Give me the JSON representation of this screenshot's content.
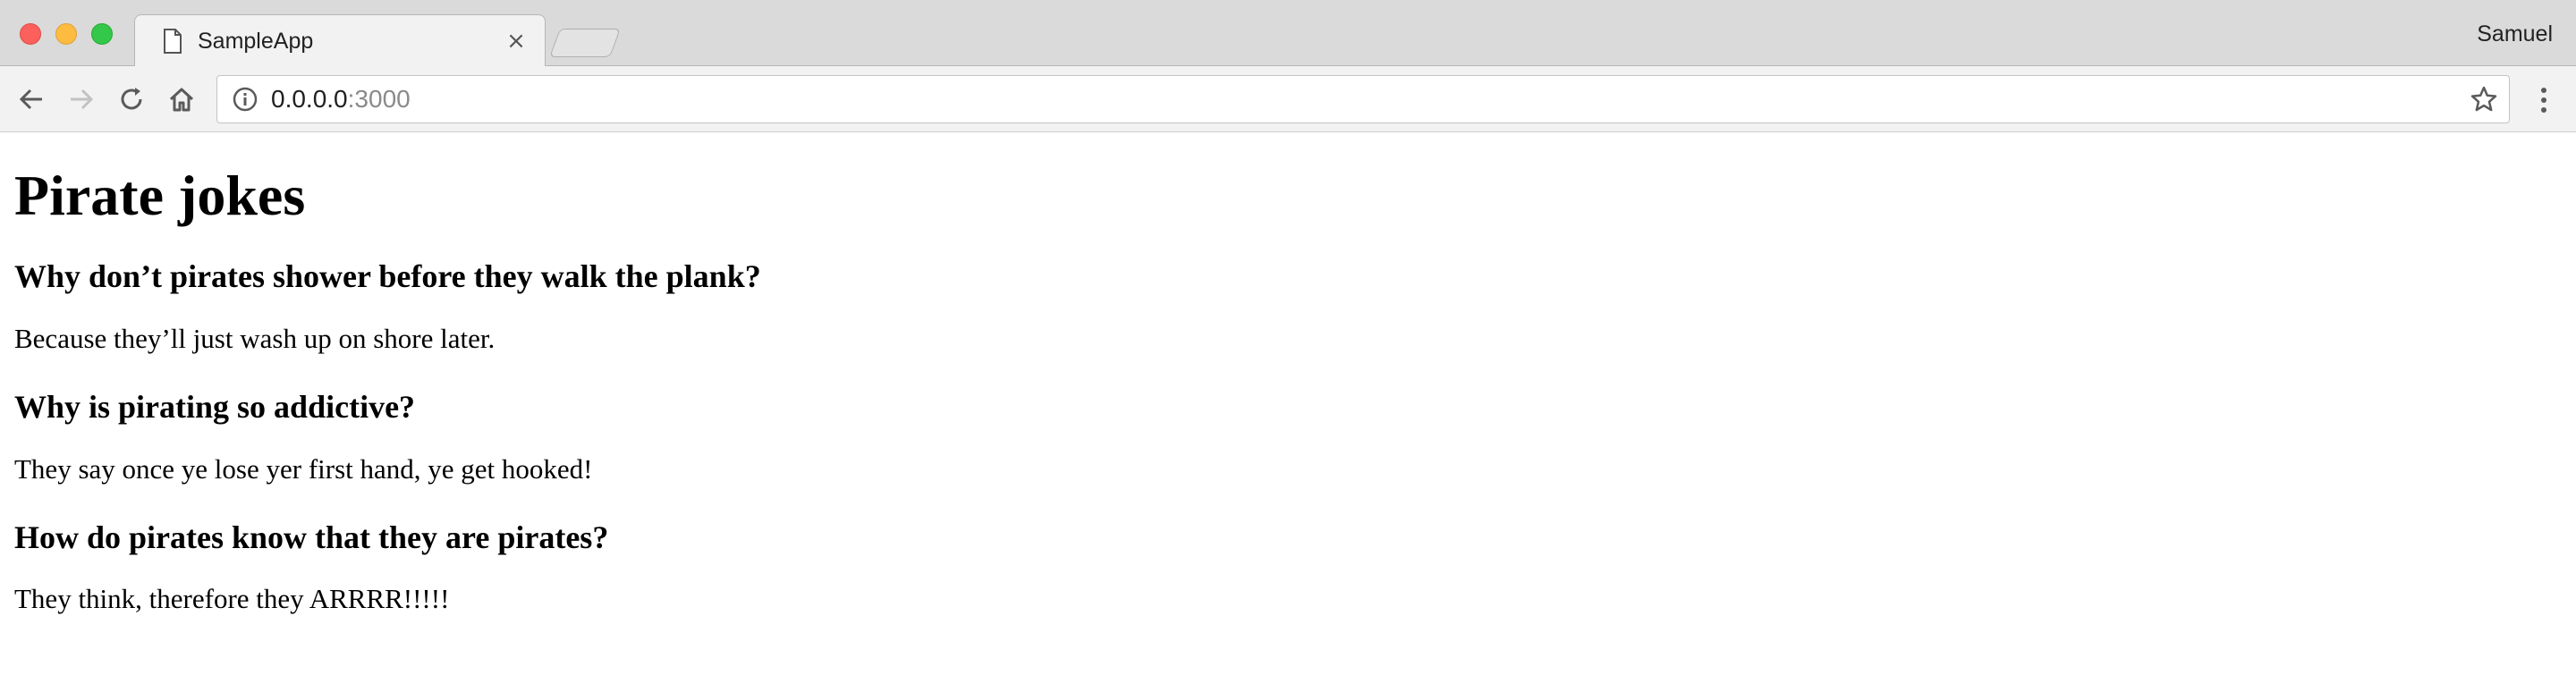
{
  "browser": {
    "tab": {
      "title": "SampleApp",
      "close_glyph": "×",
      "favicon": "document-icon"
    },
    "profile_name": "Samuel",
    "url": {
      "host": "0.0.0.0",
      "port": ":3000"
    },
    "traffic_lights": {
      "close": "#fc605c",
      "minimize": "#fdbc40",
      "maximize": "#34c84a"
    }
  },
  "page": {
    "title": "Pirate jokes",
    "jokes": [
      {
        "question": "Why don’t pirates shower before they walk the plank?",
        "answer": "Because they’ll just wash up on shore later."
      },
      {
        "question": "Why is pirating so addictive?",
        "answer": "They say once ye lose yer first hand, ye get hooked!"
      },
      {
        "question": "How do pirates know that they are pirates?",
        "answer": "They think, therefore they ARRRR!!!!!"
      }
    ]
  }
}
